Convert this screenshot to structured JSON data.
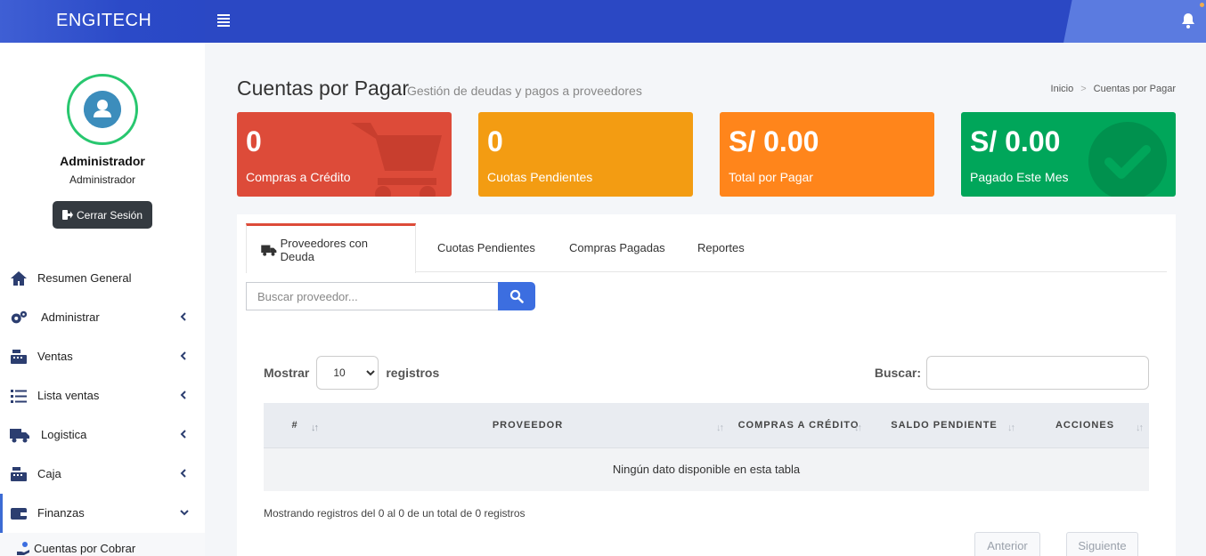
{
  "header": {
    "brand": "ENGITECH"
  },
  "sidebar": {
    "user_name": "Administrador",
    "user_role": "Administrador",
    "logout_label": "Cerrar Sesión",
    "items": [
      {
        "label": "Resumen General",
        "icon": "home-icon"
      },
      {
        "label": "Administrar",
        "icon": "cogs-icon"
      },
      {
        "label": "Ventas",
        "icon": "cash-register-icon"
      },
      {
        "label": "Lista ventas",
        "icon": "list-icon"
      },
      {
        "label": "Logistica",
        "icon": "truck-icon"
      },
      {
        "label": "Caja",
        "icon": "cash-register-icon"
      },
      {
        "label": "Finanzas",
        "icon": "wallet-icon"
      }
    ],
    "sub_items": [
      {
        "label": "Cuentas por Cobrar",
        "icon": "hand-money-icon"
      }
    ]
  },
  "page": {
    "title": "Cuentas por Pagar",
    "subtitle": "Gestión de deudas y pagos a proveedores",
    "breadcrumb": [
      "Inicio",
      "Cuentas por Pagar"
    ]
  },
  "cards": [
    {
      "value": "0",
      "label": "Compras a Crédito",
      "color": "#dd4b39",
      "icon": "shopping-cart-icon"
    },
    {
      "value": "0",
      "label": "Cuotas Pendientes",
      "color": "#f39c12",
      "icon": ""
    },
    {
      "value": "S/ 0.00",
      "label": "Total por Pagar",
      "color": "#ff851b",
      "icon": ""
    },
    {
      "value": "S/ 0.00",
      "label": "Pagado Este Mes",
      "color": "#00a65a",
      "icon": "check-circle-icon"
    }
  ],
  "tabs": [
    {
      "label": "Proveedores con Deuda",
      "active": true,
      "icon": "truck-icon"
    },
    {
      "label": "Cuotas Pendientes",
      "active": false
    },
    {
      "label": "Compras Pagadas",
      "active": false
    },
    {
      "label": "Reportes",
      "active": false
    }
  ],
  "search": {
    "placeholder": "Buscar proveedor..."
  },
  "datatable": {
    "show_label": "Mostrar",
    "length_value": "10",
    "records_label": "registros",
    "search_label": "Buscar:",
    "columns": [
      "#",
      "PROVEEDOR",
      "COMPRAS A CRÉDITO",
      "SALDO PENDIENTE",
      "ACCIONES"
    ],
    "empty_message": "Ningún dato disponible en esta tabla",
    "info": "Mostrando registros del 0 al 0 de un total de 0 registros",
    "prev_label": "Anterior",
    "next_label": "Siguiente"
  }
}
